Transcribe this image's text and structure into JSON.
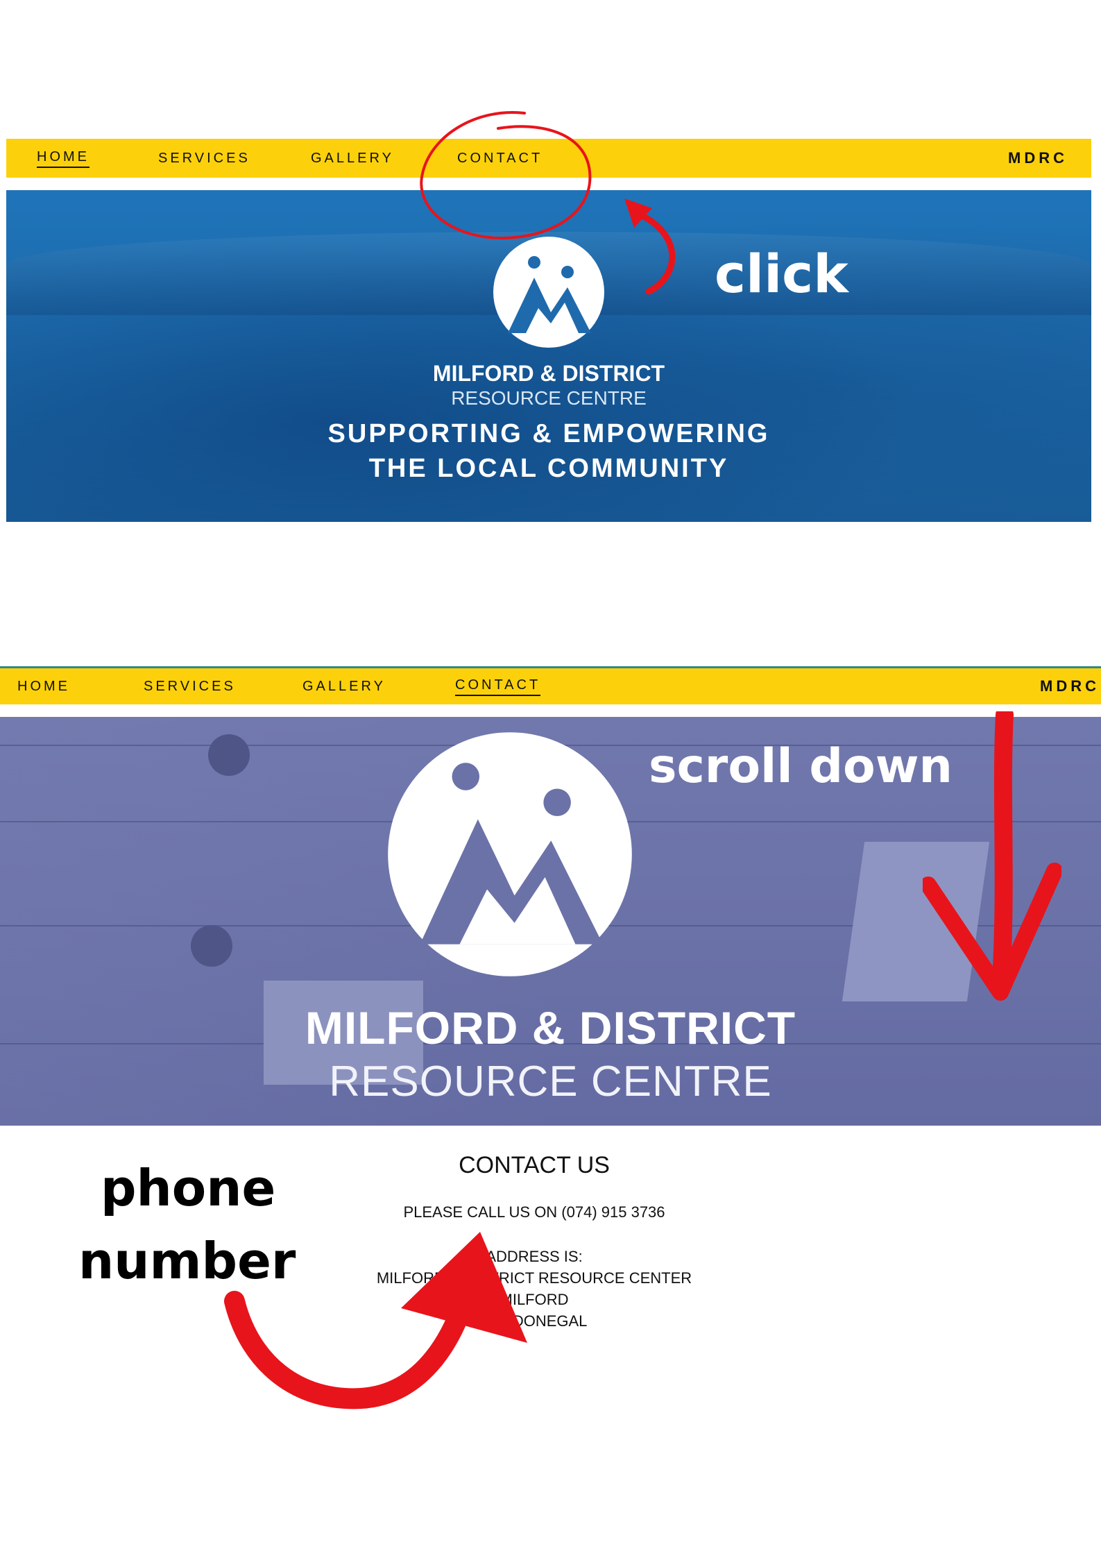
{
  "screen1": {
    "nav": {
      "items": [
        "HOME",
        "SERVICES",
        "GALLERY",
        "CONTACT"
      ],
      "brand": "MDRC"
    },
    "hero": {
      "org_name": "MILFORD & DISTRICT",
      "org_sub": "RESOURCE CENTRE",
      "tagline_line1": "SUPPORTING & EMPOWERING",
      "tagline_line2": "THE LOCAL COMMUNITY"
    },
    "annotation": "click"
  },
  "screen2": {
    "nav": {
      "items": [
        "HOME",
        "SERVICES",
        "GALLERY",
        "CONTACT"
      ],
      "brand": "MDRC"
    },
    "hero": {
      "org_name": "MILFORD & DISTRICT",
      "org_sub": "RESOURCE CENTRE"
    },
    "annotation": "scroll down",
    "contact": {
      "heading": "CONTACT US",
      "phone_line": "PLEASE CALL US ON (074) 915 3736",
      "address_label": "ADDRESS IS:",
      "address_line1": "MILFORD & DISTRICT RESOURCE CENTER",
      "address_line2": "MILFORD",
      "address_line3": "CO. DONEGAL"
    },
    "annotation_phone_line1": "phone",
    "annotation_phone_line2": "number"
  },
  "colors": {
    "nav_yellow": "#fcd10b",
    "hero1_blue": "#1d6aab",
    "hero2_purple": "#6b72a8",
    "annotation_red": "#e8141b"
  },
  "icons": [
    "mdrc-logo-icon",
    "curved-arrow-icon",
    "down-arrow-icon",
    "swoosh-arrow-icon",
    "red-circle-highlight"
  ]
}
